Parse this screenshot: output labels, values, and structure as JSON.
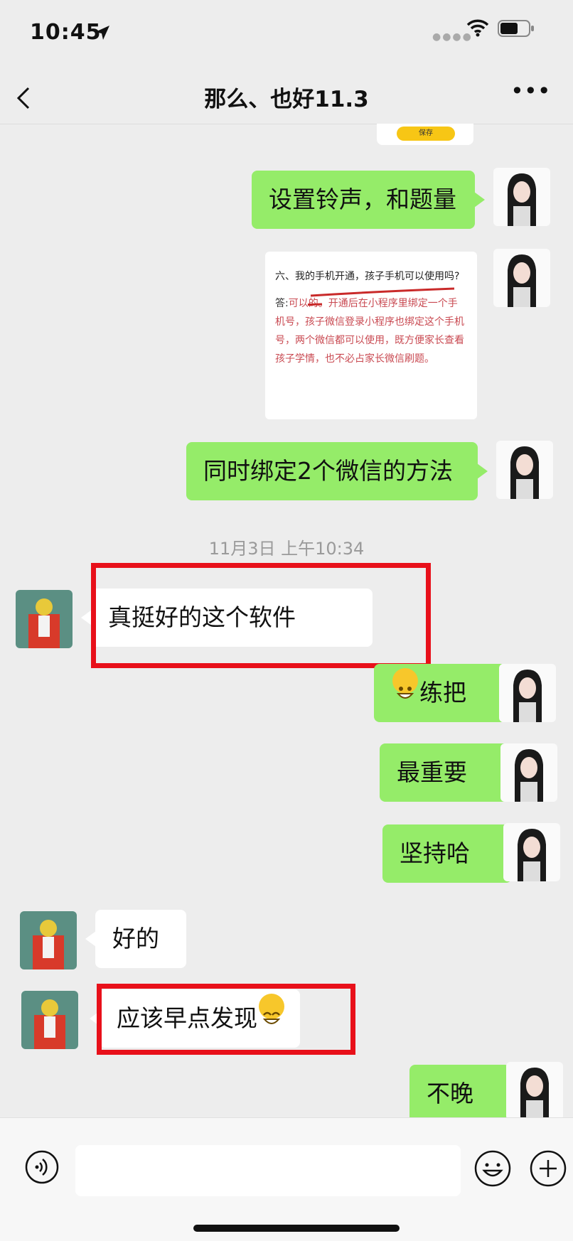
{
  "status_bar": {
    "time": "10:45"
  },
  "header": {
    "title": "那么、也好11.3"
  },
  "image_card": {
    "button": "保存"
  },
  "doc_image": {
    "question": "六、我的手机开通，孩子手机可以使用吗?",
    "answer_label": "答:",
    "answer": "可以的。开通后在小程序里绑定一个手机号，孩子微信登录小程序也绑定这个手机号，两个微信都可以使用，既方便家长查看孩子学情，也不必占家长微信刷题。"
  },
  "messages": [
    {
      "text": "设置铃声，和题量"
    },
    {
      "text": "同时绑定2个微信的方法"
    },
    {
      "text": "真挺好的这个软件"
    },
    {
      "text": "练把"
    },
    {
      "text": "最重要"
    },
    {
      "text": "坚持哈"
    },
    {
      "text": "好的"
    },
    {
      "text": "应该早点发现"
    },
    {
      "text": "不晚"
    }
  ],
  "timestamp": "11月3日 上午10:34",
  "colors": {
    "my_bubble": "#95ec69",
    "other_bubble": "#ffffff",
    "highlight_box": "#e8101a",
    "background": "#ededed"
  }
}
